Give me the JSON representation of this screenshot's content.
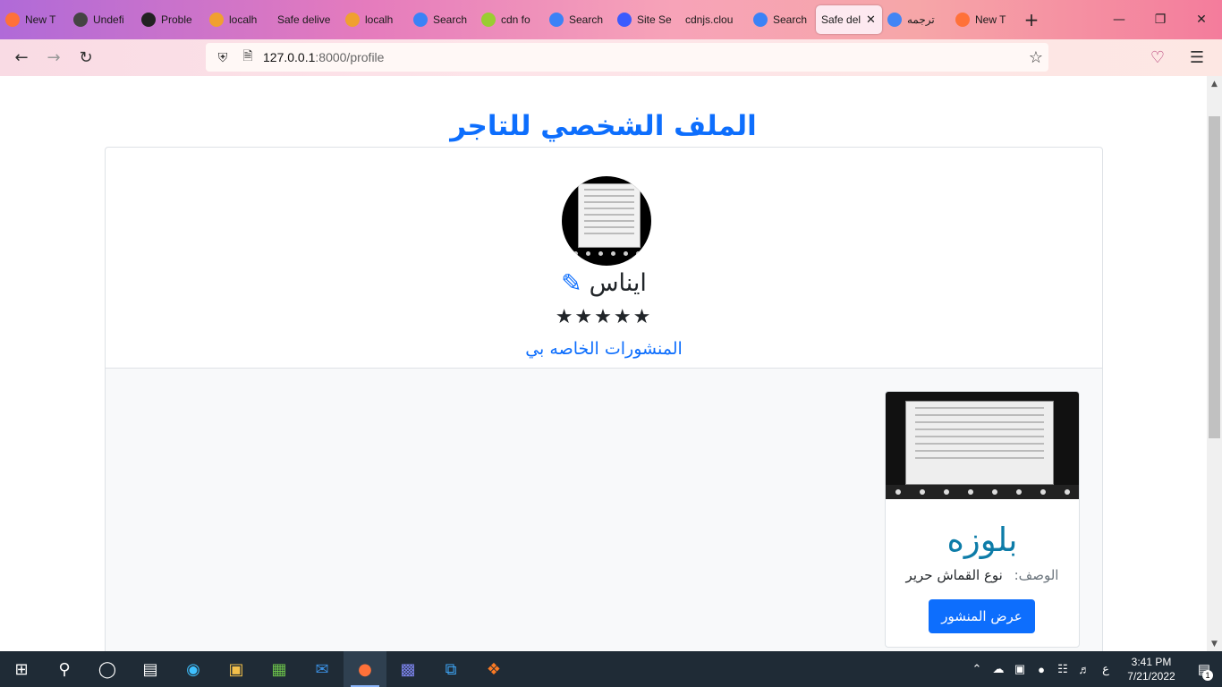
{
  "browser": {
    "tabs": [
      {
        "label": "New T",
        "icon": "firefox-icon",
        "color": "#ff7139"
      },
      {
        "label": "Undefi",
        "icon": "pencil-icon",
        "color": "#444444"
      },
      {
        "label": "Proble",
        "icon": "info-icon",
        "color": "#222222"
      },
      {
        "label": "localh",
        "icon": "pma-icon",
        "color": "#f0a030"
      },
      {
        "label": "Safe delive",
        "icon": "",
        "color": ""
      },
      {
        "label": "localh",
        "icon": "pma-icon",
        "color": "#f0a030"
      },
      {
        "label": "Search",
        "icon": "flag-icon",
        "color": "#3b82f6"
      },
      {
        "label": "cdn fo",
        "icon": "star-logo-icon",
        "color": "#9acd32"
      },
      {
        "label": "Search",
        "icon": "flag-icon",
        "color": "#3b82f6"
      },
      {
        "label": "Site Se",
        "icon": "site-icon",
        "color": "#3b5bfd"
      },
      {
        "label": "cdnjs.clou",
        "icon": "",
        "color": ""
      },
      {
        "label": "Search",
        "icon": "flag-icon",
        "color": "#3b82f6"
      },
      {
        "label": "Safe del",
        "icon": "",
        "color": "",
        "active": true
      },
      {
        "label": "ترجمه",
        "icon": "google-icon",
        "color": "#4285f4"
      },
      {
        "label": "New T",
        "icon": "firefox-icon",
        "color": "#ff7139"
      }
    ],
    "url_host": "127.0.0.1",
    "url_path": ":8000/profile"
  },
  "page": {
    "title": "الملف الشخصي للتاجر",
    "merchant_name": "ايناس",
    "rating_stars": 5,
    "stars_text": "★★★★★",
    "posts_link": "المنشورات الخاصه بي",
    "post": {
      "title": "بلوزه",
      "desc_label": "الوصف:",
      "desc_value": "نوع القماش حرير",
      "button": "عرض المنشور"
    }
  },
  "taskbar": {
    "apps": [
      "windows-start-icon",
      "search-icon",
      "cortana-icon",
      "task-view-icon",
      "edge-icon",
      "file-explorer-icon",
      "store-icon",
      "mail-icon",
      "firefox-icon",
      "teams-icon",
      "vscode-icon",
      "xampp-icon"
    ],
    "lang": "ع",
    "time": "3:41 PM",
    "date": "7/21/2022",
    "notifications": "1"
  }
}
